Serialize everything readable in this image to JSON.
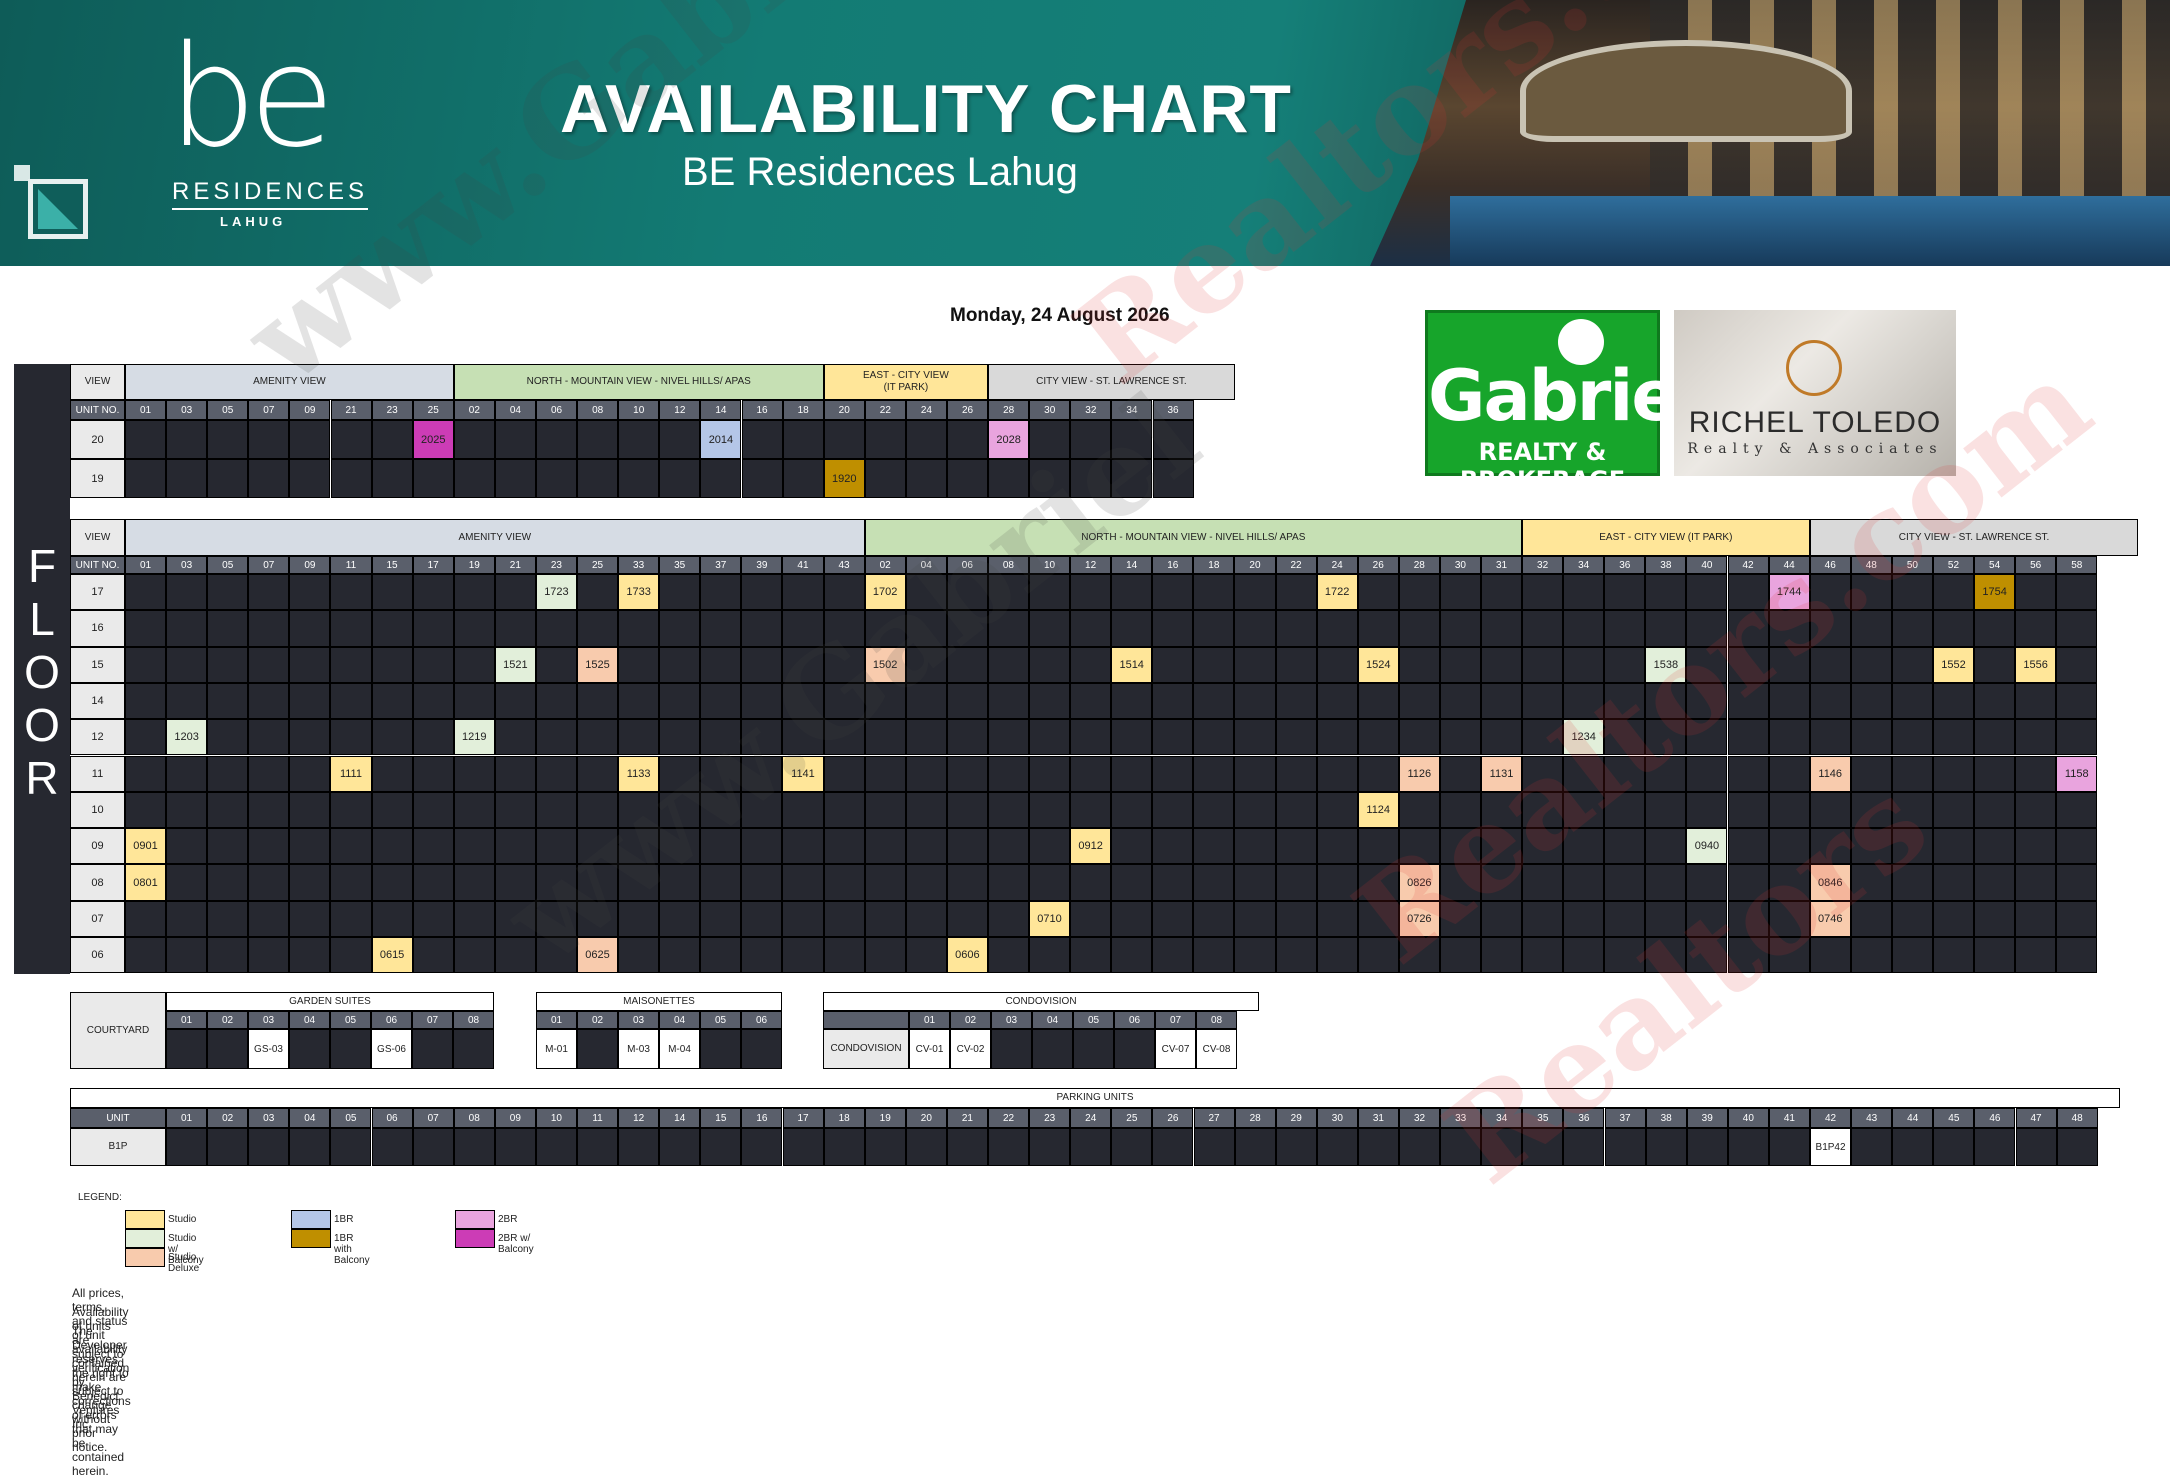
{
  "header": {
    "logo_main": "be",
    "logo_residences": "RESIDENCES",
    "logo_lahug": "LAHUG",
    "title": "AVAILABILITY CHART",
    "subtitle": "BE Residences Lahug",
    "date": "Monday, 24 August 2026"
  },
  "brands": {
    "gabriel_name": "Gabriel",
    "gabriel_sub": "REALTY & BROKERAGE",
    "richel_name": "RICHEL TOLEDO",
    "richel_sub": "Realty & Associates"
  },
  "colors": {
    "studio": "#ffe699",
    "studio_balcony": "#e2efda",
    "studio_deluxe": "#f8cbad",
    "br1": "#b4c6e7",
    "br1_balcony": "#bf8f00",
    "br2": "#e9a4de",
    "br2_balcony": "#cc3cb6",
    "amenity": "#d6dce4",
    "north": "#c6e0b4",
    "east": "#ffe699",
    "city": "#d9d9d9"
  },
  "upper": {
    "view_label": "VIEW",
    "unit_label": "UNIT NO.",
    "sections": [
      {
        "label": "AMENITY VIEW",
        "span": 8,
        "color": "amenity"
      },
      {
        "label": "NORTH - MOUNTAIN VIEW - NIVEL HILLS/ APAS",
        "span": 9,
        "color": "north"
      },
      {
        "label": "EAST - CITY VIEW\n(IT PARK)",
        "span": 4,
        "color": "east"
      },
      {
        "label": "CITY VIEW - ST. LAWRENCE ST.",
        "span": 6,
        "color": "city"
      }
    ],
    "units": [
      "01",
      "03",
      "05",
      "07",
      "09",
      "21",
      "23",
      "25",
      "02",
      "04",
      "06",
      "08",
      "10",
      "12",
      "14",
      "16",
      "18",
      "20",
      "22",
      "24",
      "26",
      "28",
      "30",
      "32",
      "34",
      "36"
    ],
    "floors": [
      {
        "floor": "20",
        "cells": [
          {
            "i": 7,
            "u": "2025",
            "t": "br2_balcony"
          },
          {
            "i": 14,
            "u": "2014",
            "t": "br1"
          },
          {
            "i": 21,
            "u": "2028",
            "t": "br2"
          }
        ]
      },
      {
        "floor": "19",
        "cells": [
          {
            "i": 17,
            "u": "1920",
            "t": "br1_balcony"
          }
        ]
      }
    ]
  },
  "lower": {
    "view_label": "VIEW",
    "unit_label": "UNIT NO.",
    "sections": [
      {
        "label": "AMENITY VIEW",
        "span": 18,
        "color": "amenity"
      },
      {
        "label": "NORTH - MOUNTAIN VIEW - NIVEL HILLS/ APAS",
        "span": 16,
        "color": "north"
      },
      {
        "label": "EAST - CITY VIEW (IT PARK)",
        "span": 7,
        "color": "east"
      },
      {
        "label": "CITY VIEW - ST. LAWRENCE ST.",
        "span": 8,
        "color": "city"
      }
    ],
    "units": [
      "01",
      "03",
      "05",
      "07",
      "09",
      "11",
      "15",
      "17",
      "19",
      "21",
      "23",
      "25",
      "33",
      "35",
      "37",
      "39",
      "41",
      "43",
      "02",
      "04",
      "06",
      "08",
      "10",
      "12",
      "14",
      "16",
      "18",
      "20",
      "22",
      "24",
      "26",
      "28",
      "30",
      "31",
      "32",
      "34",
      "36",
      "38",
      "40",
      "42",
      "44",
      "46",
      "48",
      "50",
      "52",
      "54",
      "56",
      "58"
    ],
    "floors": [
      {
        "floor": "17",
        "cells": [
          {
            "i": 10,
            "u": "1723",
            "t": "studio_balcony"
          },
          {
            "i": 12,
            "u": "1733",
            "t": "studio"
          },
          {
            "i": 18,
            "u": "1702",
            "t": "studio"
          },
          {
            "i": 29,
            "u": "1722",
            "t": "studio"
          },
          {
            "i": 40,
            "u": "1744",
            "t": "br2"
          },
          {
            "i": 45,
            "u": "1754",
            "t": "br1_balcony"
          }
        ]
      },
      {
        "floor": "16",
        "cells": []
      },
      {
        "floor": "15",
        "cells": [
          {
            "i": 9,
            "u": "1521",
            "t": "studio_balcony"
          },
          {
            "i": 11,
            "u": "1525",
            "t": "studio_deluxe"
          },
          {
            "i": 18,
            "u": "1502",
            "t": "studio_deluxe"
          },
          {
            "i": 24,
            "u": "1514",
            "t": "studio"
          },
          {
            "i": 30,
            "u": "1524",
            "t": "studio"
          },
          {
            "i": 37,
            "u": "1538",
            "t": "studio_balcony"
          },
          {
            "i": 44,
            "u": "1552",
            "t": "studio"
          },
          {
            "i": 46,
            "u": "1556",
            "t": "studio"
          }
        ]
      },
      {
        "floor": "14",
        "cells": []
      },
      {
        "floor": "12",
        "cells": [
          {
            "i": 1,
            "u": "1203",
            "t": "studio_balcony"
          },
          {
            "i": 8,
            "u": "1219",
            "t": "studio_balcony"
          },
          {
            "i": 35,
            "u": "1234",
            "t": "studio_balcony"
          }
        ]
      },
      {
        "floor": "11",
        "cells": [
          {
            "i": 5,
            "u": "1111",
            "t": "studio"
          },
          {
            "i": 12,
            "u": "1133",
            "t": "studio"
          },
          {
            "i": 16,
            "u": "1141",
            "t": "studio"
          },
          {
            "i": 31,
            "u": "1126",
            "t": "studio_deluxe"
          },
          {
            "i": 33,
            "u": "1131",
            "t": "studio_deluxe"
          },
          {
            "i": 41,
            "u": "1146",
            "t": "studio_deluxe"
          },
          {
            "i": 47,
            "u": "1158",
            "t": "br2"
          }
        ]
      },
      {
        "floor": "10",
        "cells": [
          {
            "i": 30,
            "u": "1124",
            "t": "studio"
          }
        ]
      },
      {
        "floor": "09",
        "cells": [
          {
            "i": 0,
            "u": "0901",
            "t": "studio"
          },
          {
            "i": 23,
            "u": "0912",
            "t": "studio"
          },
          {
            "i": 38,
            "u": "0940",
            "t": "studio_balcony"
          }
        ]
      },
      {
        "floor": "08",
        "cells": [
          {
            "i": 0,
            "u": "0801",
            "t": "studio"
          },
          {
            "i": 31,
            "u": "0826",
            "t": "studio_deluxe"
          },
          {
            "i": 41,
            "u": "0846",
            "t": "studio_deluxe"
          }
        ]
      },
      {
        "floor": "07",
        "cells": [
          {
            "i": 22,
            "u": "0710",
            "t": "studio"
          },
          {
            "i": 31,
            "u": "0726",
            "t": "studio_deluxe"
          },
          {
            "i": 41,
            "u": "0746",
            "t": "studio_deluxe"
          }
        ]
      },
      {
        "floor": "06",
        "cells": [
          {
            "i": 6,
            "u": "0615",
            "t": "studio"
          },
          {
            "i": 11,
            "u": "0625",
            "t": "studio_deluxe"
          },
          {
            "i": 20,
            "u": "0606",
            "t": "studio"
          }
        ]
      }
    ],
    "floor_letters": [
      "F",
      "L",
      "O",
      "O",
      "R"
    ]
  },
  "courtyard": {
    "label": "COURTYARD",
    "garden_title": "GARDEN SUITES",
    "garden_units": [
      "01",
      "02",
      "03",
      "04",
      "05",
      "06",
      "07",
      "08"
    ],
    "garden_values": [
      "",
      "",
      "GS-03",
      "",
      "",
      "GS-06",
      "",
      ""
    ],
    "mais_title": "MAISONETTES",
    "mais_units": [
      "01",
      "02",
      "03",
      "04",
      "05",
      "06"
    ],
    "mais_values": [
      "M-01",
      "",
      "M-03",
      "M-04",
      "",
      ""
    ],
    "condo_title": "CONDOVISION",
    "condo_label": "CONDOVISION",
    "condo_units": [
      "01",
      "02",
      "03",
      "04",
      "05",
      "06",
      "07",
      "08"
    ],
    "condo_values": [
      "CV-01",
      "CV-02",
      "",
      "",
      "",
      "",
      "CV-07",
      "CV-08"
    ]
  },
  "parking": {
    "title": "PARKING UNITS",
    "unit_label": "UNIT",
    "level": "B1P",
    "units": [
      "01",
      "02",
      "03",
      "04",
      "05",
      "06",
      "07",
      "08",
      "09",
      "10",
      "11",
      "12",
      "14",
      "15",
      "16",
      "17",
      "18",
      "19",
      "20",
      "21",
      "22",
      "23",
      "24",
      "25",
      "26",
      "27",
      "28",
      "29",
      "30",
      "31",
      "32",
      "33",
      "34",
      "35",
      "36",
      "37",
      "38",
      "39",
      "40",
      "41",
      "42",
      "43",
      "44",
      "45",
      "46",
      "47",
      "48"
    ],
    "values": {
      "40": "B1P42"
    }
  },
  "legend": {
    "title": "LEGEND:",
    "studio": "Studio",
    "studio_balcony": "Studio w/ Balcony",
    "studio_deluxe": "Studio Deluxe",
    "br1": "1BR",
    "br1_balcony": "1BR with Balcony",
    "br2": "2BR",
    "br2_balcony": "2BR w/ Balcony"
  },
  "notes": [
    "All prices, terms, and status of unit availability contained herein are subject to change without prior notice.",
    "Availability of units are subject to verification by Benedict Ventures Inc.",
    "The Developer reserves the right to make corrections of errors that may be contained herein."
  ],
  "watermarks": [
    "www.Gabriel",
    "Realtors.com",
    "www.Gabriel",
    "Realtors.com",
    "Realtors"
  ]
}
